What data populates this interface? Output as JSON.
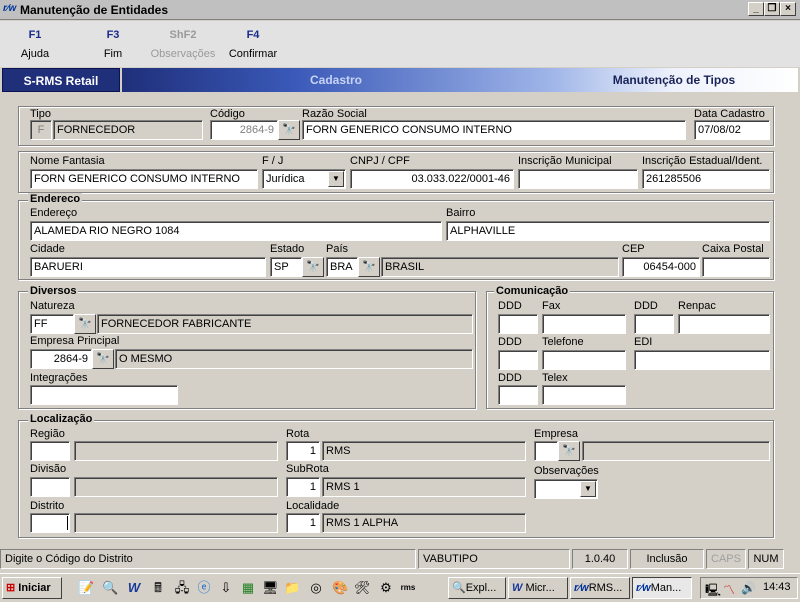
{
  "window": {
    "title": "Manutenção de Entidades",
    "app_icon": "rms-logo-icon"
  },
  "function_keys": [
    {
      "key": "F1",
      "label": "Ajuda",
      "enabled": true
    },
    {
      "key": "F3",
      "label": "Fim",
      "enabled": true
    },
    {
      "key": "ShF2",
      "label": "Observações",
      "enabled": false
    },
    {
      "key": "F4",
      "label": "Confirmar",
      "enabled": true
    }
  ],
  "header": {
    "brand": "S-RMS Retail",
    "section": "Cadastro",
    "screen": "Manutenção de Tipos"
  },
  "entity": {
    "tipo_label": "Tipo",
    "tipo_code": "F",
    "tipo_desc": "FORNECEDOR",
    "codigo_label": "Código",
    "codigo": "2864-9",
    "razao_label": "Razão Social",
    "razao": "FORN GENERICO CONSUMO INTERNO",
    "data_label": "Data Cadastro",
    "data": "07/08/02",
    "fantasia_label": "Nome Fantasia",
    "fantasia": "FORN GENERICO CONSUMO INTERNO",
    "fj_label": "F / J",
    "fj": "Jurídica",
    "cnpj_label": "CNPJ / CPF",
    "cnpj": "03.033.022/0001-46",
    "im_label": "Inscrição Municipal",
    "im": "",
    "ie_label": "Inscrição Estadual/Ident.",
    "ie": "261285506"
  },
  "endereco": {
    "title": "Endereco",
    "endereco_label": "Endereço",
    "endereco": "ALAMEDA RIO NEGRO 1084",
    "bairro_label": "Bairro",
    "bairro": "ALPHAVILLE",
    "cidade_label": "Cidade",
    "cidade": "BARUERI",
    "estado_label": "Estado",
    "estado": "SP",
    "pais_label": "País",
    "pais_code": "BRA",
    "pais": "BRASIL",
    "cep_label": "CEP",
    "cep": "06454-000",
    "caixa_label": "Caixa Postal",
    "caixa": ""
  },
  "diversos": {
    "title": "Diversos",
    "natureza_label": "Natureza",
    "natureza_code": "FF",
    "natureza": "FORNECEDOR FABRICANTE",
    "empresa_label": "Empresa Principal",
    "empresa_code": "2864-9",
    "empresa": "O MESMO",
    "integracoes_label": "Integrações",
    "integracoes": ""
  },
  "comunicacao": {
    "title": "Comunicação",
    "ddd_label": "DDD",
    "fax_label": "Fax",
    "renpac_label": "Renpac",
    "telefone_label": "Telefone",
    "edi_label": "EDI",
    "telex_label": "Telex"
  },
  "localizacao": {
    "title": "Localização",
    "regiao_label": "Região",
    "divisao_label": "Divisão",
    "distrito_label": "Distrito",
    "rota_label": "Rota",
    "rota_code": "1",
    "rota": "RMS",
    "subrota_label": "SubRota",
    "subrota_code": "1",
    "subrota": "RMS 1",
    "localidade_label": "Localidade",
    "localidade_code": "1",
    "localidade": "RMS 1 ALPHA",
    "empresa_label": "Empresa",
    "observacoes_label": "Observações"
  },
  "status": {
    "message": "Digite o Código do Distrito",
    "program": "VABUTIPO",
    "version": "1.0.40",
    "mode": "Inclusão",
    "caps": "CAPS",
    "num": "NUM"
  },
  "taskbar": {
    "start": "Iniciar",
    "tasks": [
      "Expl...",
      "Micr...",
      "RMS...",
      "Man..."
    ],
    "clock": "14:43"
  }
}
